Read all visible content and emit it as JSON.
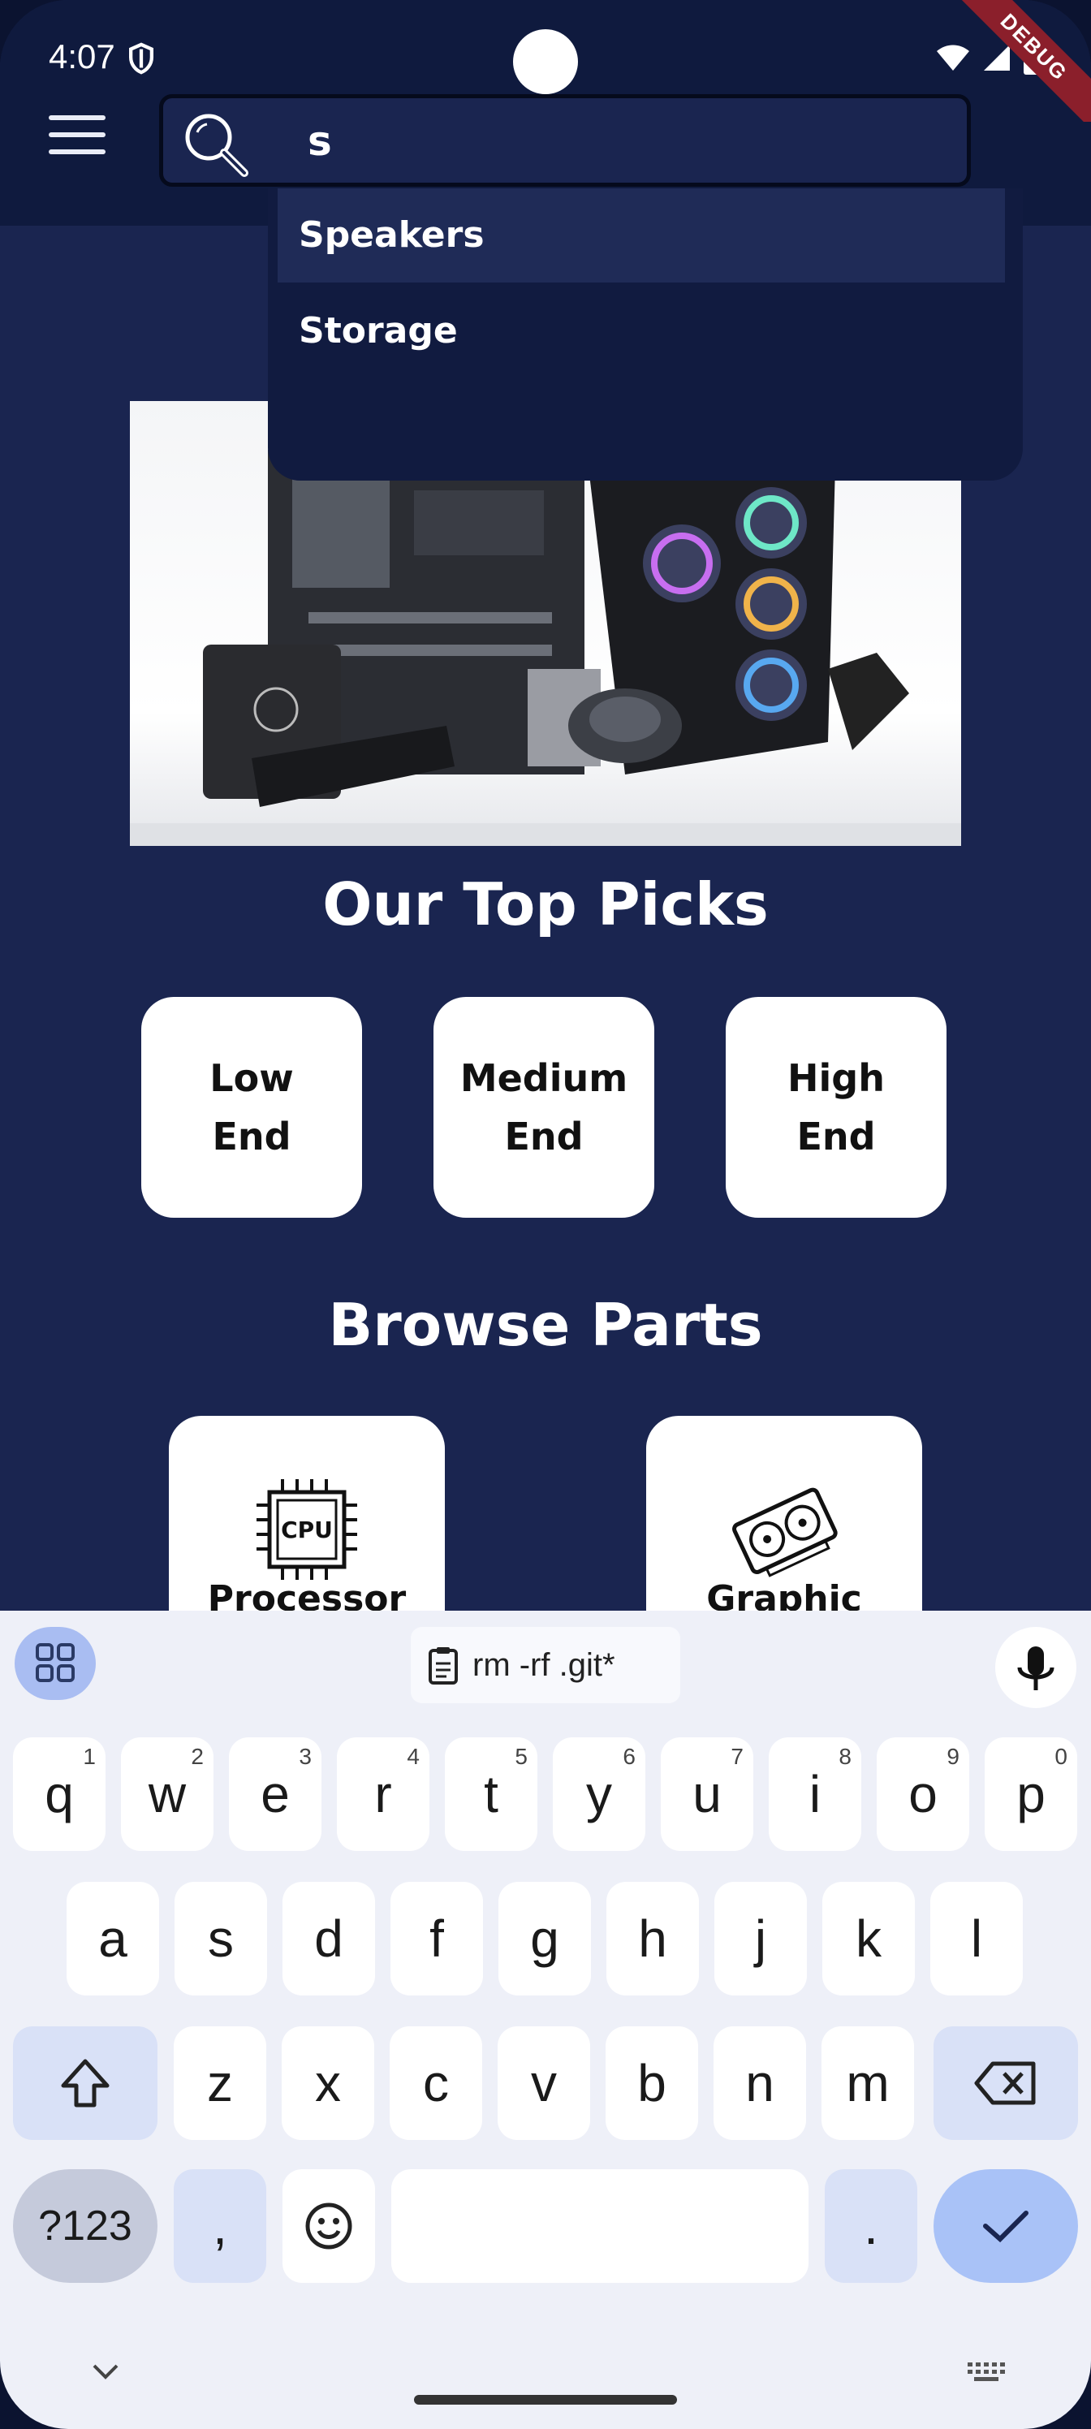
{
  "status_bar": {
    "time": "4:07",
    "debug_label": "DEBUG"
  },
  "search": {
    "value": "s"
  },
  "suggestions": [
    "Speakers",
    "Storage"
  ],
  "hero": {
    "alt": "PC components banner"
  },
  "top_picks": {
    "title": "Our Top Picks",
    "items": [
      {
        "line1": "Low",
        "line2": "End"
      },
      {
        "line1": "Medium",
        "line2": "End"
      },
      {
        "line1": "High",
        "line2": "End"
      }
    ]
  },
  "browse_parts": {
    "title": "Browse Parts",
    "items": [
      {
        "label": "Processor",
        "icon": "cpu-icon",
        "icon_text": "CPU"
      },
      {
        "label": "Graphic",
        "icon": "gpu-icon"
      }
    ]
  },
  "keyboard": {
    "clipboard_text": "rm -rf .git*",
    "row1": [
      {
        "k": "q",
        "n": "1"
      },
      {
        "k": "w",
        "n": "2"
      },
      {
        "k": "e",
        "n": "3"
      },
      {
        "k": "r",
        "n": "4"
      },
      {
        "k": "t",
        "n": "5"
      },
      {
        "k": "y",
        "n": "6"
      },
      {
        "k": "u",
        "n": "7"
      },
      {
        "k": "i",
        "n": "8"
      },
      {
        "k": "o",
        "n": "9"
      },
      {
        "k": "p",
        "n": "0"
      }
    ],
    "row2": [
      "a",
      "s",
      "d",
      "f",
      "g",
      "h",
      "j",
      "k",
      "l"
    ],
    "row3": [
      "z",
      "x",
      "c",
      "v",
      "b",
      "n",
      "m"
    ],
    "symbols_label": "?123",
    "comma": ",",
    "period": "."
  },
  "colors": {
    "background": "#1a2550",
    "appbar": "#0f1a3e",
    "card": "#ffffff",
    "accent": "#a9c2f7"
  }
}
